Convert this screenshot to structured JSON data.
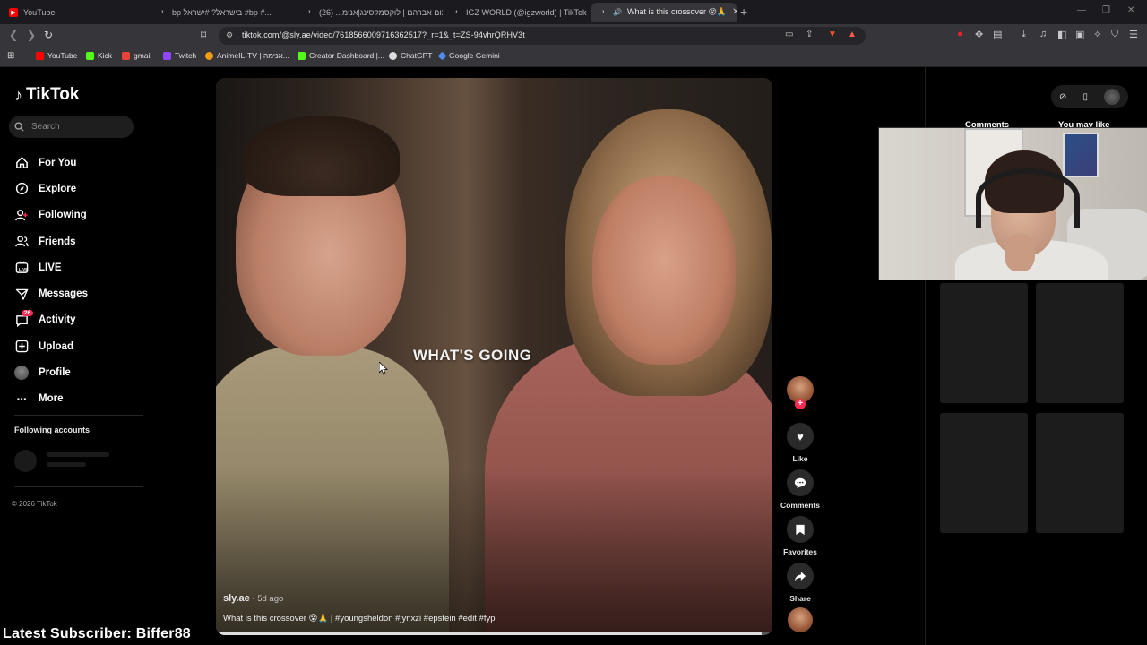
{
  "browser": {
    "tabs": [
      {
        "title": "YouTube",
        "icon": "youtube-icon",
        "color": "#ff0000"
      },
      {
        "title": "bp בישראל? #ישראל #bp #...",
        "icon": "tiktok-icon",
        "color": "#ffffff"
      },
      {
        "title": "תום אברהם | לוקסמקסינג|אנימ... (26)",
        "icon": "tiktok-icon",
        "color": "#ffffff"
      },
      {
        "title": "IGZ WORLD (@igzworld) | TikTok",
        "icon": "tiktok-icon",
        "color": "#ffffff"
      },
      {
        "title": "What is this crossover 😵🙏",
        "icon": "tiktok-icon",
        "color": "#ffffff",
        "active": true
      }
    ],
    "url": "tiktok.com/@sly.ae/video/7618566009716362517?_r=1&_t=ZS-94vhrQRHV3t",
    "bookmarks": [
      {
        "label": "YouTube",
        "color": "#ff0000"
      },
      {
        "label": "Kick",
        "color": "#53fc18"
      },
      {
        "label": "gmail",
        "color": "#ea4335"
      },
      {
        "label": "Twitch",
        "color": "#9146ff"
      },
      {
        "label": "AnimeIL-TV | אנימה...",
        "color": "#f39c12"
      },
      {
        "label": "Creator Dashboard |...",
        "color": "#53fc18"
      },
      {
        "label": "ChatGPT",
        "color": "#dddddd"
      },
      {
        "label": "Google Gemini",
        "color": "#4f8df5"
      }
    ]
  },
  "tiktok": {
    "brand": "TikTok",
    "search_placeholder": "Search",
    "nav": [
      {
        "label": "For You",
        "icon": "home-icon"
      },
      {
        "label": "Explore",
        "icon": "compass-icon"
      },
      {
        "label": "Following",
        "icon": "following-icon"
      },
      {
        "label": "Friends",
        "icon": "friends-icon"
      },
      {
        "label": "LIVE",
        "icon": "live-icon"
      },
      {
        "label": "Messages",
        "icon": "messages-icon"
      },
      {
        "label": "Activity",
        "icon": "activity-icon",
        "badge": "26"
      },
      {
        "label": "Upload",
        "icon": "upload-icon"
      },
      {
        "label": "Profile",
        "icon": "profile-avatar"
      },
      {
        "label": "More",
        "icon": "more-icon"
      }
    ],
    "following_accounts_title": "Following accounts",
    "copyright": "© 2026 TikTok"
  },
  "video": {
    "overlay_text": "WHAT'S GOING",
    "author": "sly.ae",
    "age": " · 5d ago",
    "description": "What is this crossover 😵🙏 | #youngsheldon #jynxzi #epstein #edit #fyp",
    "progress": 0.98
  },
  "actions": [
    {
      "label": "Like",
      "icon": "heart-icon"
    },
    {
      "label": "Comments",
      "icon": "comment-icon"
    },
    {
      "label": "Favorites",
      "icon": "bookmark-icon"
    },
    {
      "label": "Share",
      "icon": "share-icon"
    }
  ],
  "right_panel": {
    "tabs": [
      "Comments",
      "You may like"
    ]
  },
  "stream_overlay": {
    "latest_subscriber": "Latest Subscriber: Biffer88"
  },
  "colors": {
    "accent": "#fe2c55",
    "background": "#000000",
    "chrome": "#35353a"
  }
}
